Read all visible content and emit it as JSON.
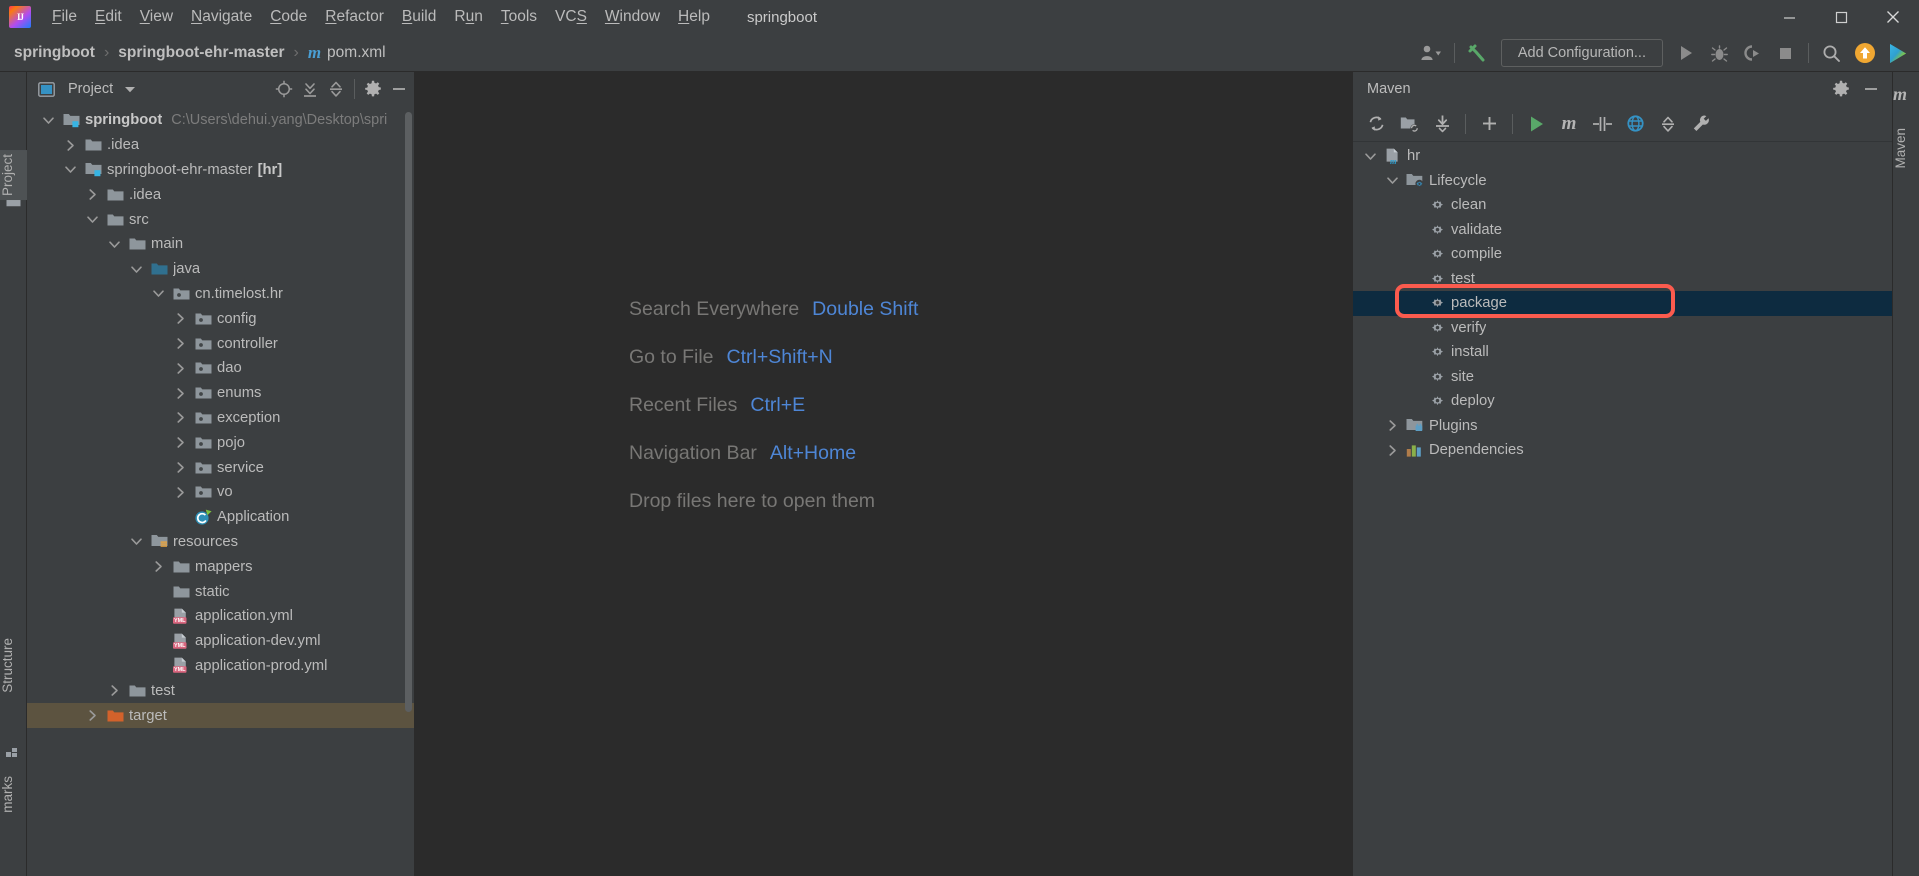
{
  "window": {
    "title": "springboot",
    "logo_text": "IJ",
    "controls": [
      "minimize-icon",
      "maximize-icon",
      "close-icon"
    ]
  },
  "menubar": {
    "items": [
      {
        "label": "File",
        "mnemonic": "F"
      },
      {
        "label": "Edit",
        "mnemonic": "E"
      },
      {
        "label": "View",
        "mnemonic": "V"
      },
      {
        "label": "Navigate",
        "mnemonic": "N"
      },
      {
        "label": "Code",
        "mnemonic": "C"
      },
      {
        "label": "Refactor",
        "mnemonic": "R"
      },
      {
        "label": "Build",
        "mnemonic": "B"
      },
      {
        "label": "Run",
        "mnemonic": "u"
      },
      {
        "label": "Tools",
        "mnemonic": "T"
      },
      {
        "label": "VCS",
        "mnemonic": "S"
      },
      {
        "label": "Window",
        "mnemonic": "W"
      },
      {
        "label": "Help",
        "mnemonic": "H"
      }
    ]
  },
  "navbar": {
    "breadcrumbs": [
      {
        "label": "springboot",
        "bold": true,
        "icon": ""
      },
      {
        "label": "springboot-ehr-master",
        "bold": true,
        "icon": ""
      },
      {
        "label": "pom.xml",
        "bold": false,
        "icon": "maven-m-icon"
      }
    ],
    "separator": "›",
    "add_configuration_label": "Add Configuration...",
    "icons": [
      "user-account-icon",
      "build-hammer-icon",
      "run-icon",
      "debug-icon",
      "run-with-coverage-icon",
      "stop-icon",
      "search-everywhere-icon",
      "update-project-icon",
      "ide-features-trainer-icon"
    ]
  },
  "left_stripe": {
    "tabs": [
      {
        "label": "Project",
        "active": true
      },
      {
        "label": "Structure",
        "active": false
      },
      {
        "label": "marks",
        "active": false
      }
    ]
  },
  "right_stripe": {
    "tabs": [
      {
        "label": "Maven",
        "active": false
      }
    ],
    "logo": "m"
  },
  "project_panel": {
    "title": "Project",
    "toolbar_icons": [
      "select-opened-file-icon",
      "expand-all-icon",
      "collapse-all-icon",
      "settings-gear-icon",
      "hide-icon"
    ],
    "tree": [
      {
        "id": "springboot",
        "label": "springboot",
        "indent": 0,
        "twisty": "open",
        "icon": "module-folder-icon",
        "bold": true,
        "path": "C:\\Users\\dehui.yang\\Desktop\\spri"
      },
      {
        "id": "idea-root",
        "label": ".idea",
        "indent": 1,
        "twisty": "closed",
        "icon": "folder-icon",
        "bold": false,
        "path": ""
      },
      {
        "id": "springboot-ehr-master",
        "label": "springboot-ehr-master",
        "indent": 1,
        "twisty": "open",
        "icon": "module-folder-icon",
        "bold": false,
        "path": "",
        "suffix": "[hr]"
      },
      {
        "id": "idea-module",
        "label": ".idea",
        "indent": 2,
        "twisty": "closed",
        "icon": "folder-icon",
        "bold": false,
        "path": ""
      },
      {
        "id": "src",
        "label": "src",
        "indent": 2,
        "twisty": "open",
        "icon": "folder-icon",
        "bold": false,
        "path": ""
      },
      {
        "id": "main",
        "label": "main",
        "indent": 3,
        "twisty": "open",
        "icon": "folder-icon",
        "bold": false,
        "path": ""
      },
      {
        "id": "java",
        "label": "java",
        "indent": 4,
        "twisty": "open",
        "icon": "source-root-folder-icon",
        "bold": false,
        "path": ""
      },
      {
        "id": "cn-timelost-hr",
        "label": "cn.timelost.hr",
        "indent": 5,
        "twisty": "open",
        "icon": "package-icon",
        "bold": false,
        "path": ""
      },
      {
        "id": "config",
        "label": "config",
        "indent": 6,
        "twisty": "closed",
        "icon": "package-icon",
        "bold": false,
        "path": ""
      },
      {
        "id": "controller",
        "label": "controller",
        "indent": 6,
        "twisty": "closed",
        "icon": "package-icon",
        "bold": false,
        "path": ""
      },
      {
        "id": "dao",
        "label": "dao",
        "indent": 6,
        "twisty": "closed",
        "icon": "package-icon",
        "bold": false,
        "path": ""
      },
      {
        "id": "enums",
        "label": "enums",
        "indent": 6,
        "twisty": "closed",
        "icon": "package-icon",
        "bold": false,
        "path": ""
      },
      {
        "id": "exception",
        "label": "exception",
        "indent": 6,
        "twisty": "closed",
        "icon": "package-icon",
        "bold": false,
        "path": ""
      },
      {
        "id": "pojo",
        "label": "pojo",
        "indent": 6,
        "twisty": "closed",
        "icon": "package-icon",
        "bold": false,
        "path": ""
      },
      {
        "id": "service",
        "label": "service",
        "indent": 6,
        "twisty": "closed",
        "icon": "package-icon",
        "bold": false,
        "path": ""
      },
      {
        "id": "vo",
        "label": "vo",
        "indent": 6,
        "twisty": "closed",
        "icon": "package-icon",
        "bold": false,
        "path": ""
      },
      {
        "id": "application-class",
        "label": "Application",
        "indent": 6,
        "twisty": "none",
        "icon": "runnable-class-icon",
        "bold": false,
        "path": ""
      },
      {
        "id": "resources",
        "label": "resources",
        "indent": 4,
        "twisty": "open",
        "icon": "resources-root-folder-icon",
        "bold": false,
        "path": ""
      },
      {
        "id": "mappers",
        "label": "mappers",
        "indent": 5,
        "twisty": "closed",
        "icon": "folder-icon",
        "bold": false,
        "path": ""
      },
      {
        "id": "static",
        "label": "static",
        "indent": 5,
        "twisty": "none",
        "icon": "folder-icon",
        "bold": false,
        "path": ""
      },
      {
        "id": "application-yml",
        "label": "application.yml",
        "indent": 5,
        "twisty": "none",
        "icon": "yml-file-icon",
        "bold": false,
        "path": ""
      },
      {
        "id": "application-dev-yml",
        "label": "application-dev.yml",
        "indent": 5,
        "twisty": "none",
        "icon": "yml-file-icon",
        "bold": false,
        "path": ""
      },
      {
        "id": "application-prod-yml",
        "label": "application-prod.yml",
        "indent": 5,
        "twisty": "none",
        "icon": "yml-file-icon",
        "bold": false,
        "path": ""
      },
      {
        "id": "test",
        "label": "test",
        "indent": 3,
        "twisty": "closed",
        "icon": "folder-icon",
        "bold": false,
        "path": ""
      },
      {
        "id": "target",
        "label": "target",
        "indent": 2,
        "twisty": "closed",
        "icon": "excluded-folder-icon",
        "bold": false,
        "path": "",
        "highlight": "target"
      }
    ]
  },
  "editor": {
    "hints": [
      {
        "label": "Search Everywhere",
        "key": "Double Shift"
      },
      {
        "label": "Go to File",
        "key": "Ctrl+Shift+N"
      },
      {
        "label": "Recent Files",
        "key": "Ctrl+E"
      },
      {
        "label": "Navigation Bar",
        "key": "Alt+Home"
      }
    ],
    "drop_text": "Drop files here to open them"
  },
  "maven_panel": {
    "title": "Maven",
    "header_icons": [
      "settings-gear-icon",
      "hide-icon"
    ],
    "toolbar_icons": [
      "reload-all-maven-projects-icon",
      "generate-sources-icon",
      "download-sources-icon",
      "add-maven-project-icon",
      "execute-maven-goal-icon",
      "maven-settings-m-icon",
      "toggle-skip-tests-icon",
      "offline-mode-icon",
      "collapse-all-icon",
      "maven-settings-wrench-icon"
    ],
    "tree": [
      {
        "id": "hr",
        "label": "hr",
        "indent": 0,
        "twisty": "open",
        "icon": "maven-project-icon",
        "selected": false
      },
      {
        "id": "lifecycle",
        "label": "Lifecycle",
        "indent": 1,
        "twisty": "open",
        "icon": "lifecycle-folder-icon",
        "selected": false
      },
      {
        "id": "clean",
        "label": "clean",
        "indent": 2,
        "twisty": "none",
        "icon": "maven-goal-icon",
        "selected": false
      },
      {
        "id": "validate",
        "label": "validate",
        "indent": 2,
        "twisty": "none",
        "icon": "maven-goal-icon",
        "selected": false
      },
      {
        "id": "compile",
        "label": "compile",
        "indent": 2,
        "twisty": "none",
        "icon": "maven-goal-icon",
        "selected": false
      },
      {
        "id": "test",
        "label": "test",
        "indent": 2,
        "twisty": "none",
        "icon": "maven-goal-icon",
        "selected": false
      },
      {
        "id": "package",
        "label": "package",
        "indent": 2,
        "twisty": "none",
        "icon": "maven-goal-icon",
        "selected": true
      },
      {
        "id": "verify",
        "label": "verify",
        "indent": 2,
        "twisty": "none",
        "icon": "maven-goal-icon",
        "selected": false
      },
      {
        "id": "install",
        "label": "install",
        "indent": 2,
        "twisty": "none",
        "icon": "maven-goal-icon",
        "selected": false
      },
      {
        "id": "site",
        "label": "site",
        "indent": 2,
        "twisty": "none",
        "icon": "maven-goal-icon",
        "selected": false
      },
      {
        "id": "deploy",
        "label": "deploy",
        "indent": 2,
        "twisty": "none",
        "icon": "maven-goal-icon",
        "selected": false
      },
      {
        "id": "plugins",
        "label": "Plugins",
        "indent": 1,
        "twisty": "closed",
        "icon": "plugins-folder-icon",
        "selected": false
      },
      {
        "id": "dependencies",
        "label": "Dependencies",
        "indent": 1,
        "twisty": "closed",
        "icon": "dependencies-icon",
        "selected": false
      }
    ]
  },
  "annotation": {
    "target": "package",
    "color": "#fb5b4e"
  },
  "colors": {
    "panel_bg": "#3c3f41",
    "editor_bg": "#2b2b2b",
    "selection": "#0d2b40",
    "target_highlight": "#5c5340",
    "hint_key": "#4e86d6",
    "accent_blue": "#4a9fd4",
    "annotation_red": "#fb5b4e"
  }
}
